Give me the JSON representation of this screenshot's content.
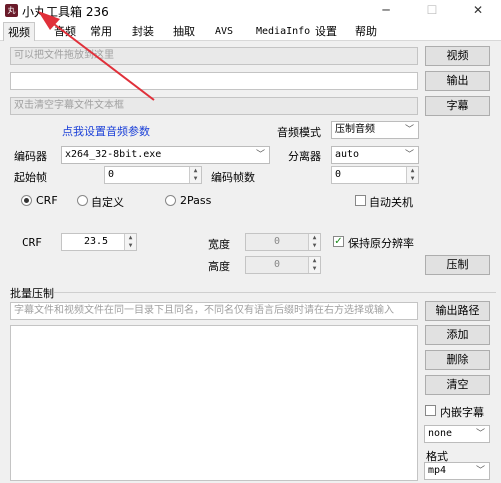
{
  "window": {
    "title": "小丸工具箱 236",
    "app_icon": "xiaowan-app-icon",
    "minimize": "─",
    "maximize": "☐",
    "close": "✕"
  },
  "tabs": [
    {
      "label": "视频"
    },
    {
      "label": "音频"
    },
    {
      "label": "常用"
    },
    {
      "label": "封装"
    },
    {
      "label": "抽取"
    },
    {
      "label": "AVS"
    },
    {
      "label": "MediaInfo"
    },
    {
      "label": "设置"
    },
    {
      "label": "帮助"
    }
  ],
  "files": {
    "video_input_placeholder": "可以把文件拖放到这里",
    "output_value": "",
    "subtitle_placeholder": "双击清空字幕文件文本框",
    "video_button": "视频",
    "output_button": "输出",
    "subtitle_button": "字幕"
  },
  "audio": {
    "link": "点我设置音频参数",
    "mode_label": "音频模式",
    "mode_value": "压制音频"
  },
  "encoder": {
    "label": "编码器",
    "value": "x264_32-8bit.exe",
    "splitter_label": "分离器",
    "splitter_value": "auto",
    "start_frame_label": "起始帧",
    "start_frame_value": "0",
    "encode_frames_label": "编码帧数",
    "encode_frames_value": "0"
  },
  "rate_mode": {
    "crf_label": "CRF",
    "custom_label": "自定义",
    "twopass_label": "2Pass",
    "selected": "CRF",
    "autoshutdown_label": "自动关机"
  },
  "crf": {
    "label": "CRF",
    "value": "23.5",
    "width_label": "宽度",
    "width_value": "0",
    "height_label": "高度",
    "height_value": "0",
    "keep_res_label": "保持原分辨率",
    "keep_res_checked": true,
    "encode_button": "压制"
  },
  "batch": {
    "title": "批量压制",
    "hint": "字幕文件和视频文件在同一目录下且同名，不同名仅有语言后缀时请在右方选择或输入",
    "output_path_button": "输出路径",
    "add_button": "添加",
    "delete_button": "删除",
    "clear_button": "清空",
    "embed_sub_label": "内嵌字幕",
    "lang_value": "none",
    "format_label": "格式",
    "format_value": "mp4"
  },
  "colors": {
    "link": "#1a3fd8",
    "arrow": "#e0303a",
    "check": "#1a8a1a"
  }
}
